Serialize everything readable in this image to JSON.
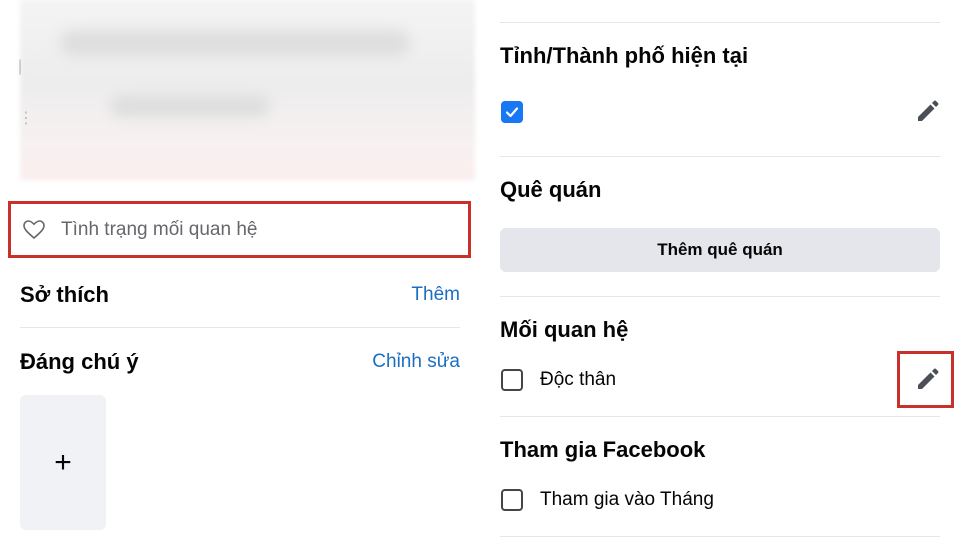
{
  "left": {
    "relationship_placeholder": "Tình trạng mối quan hệ",
    "interests": {
      "title": "Sở thích",
      "action": "Thêm"
    },
    "featured": {
      "title": "Đáng chú ý",
      "action": "Chỉnh sửa",
      "add_symbol": "+"
    }
  },
  "right": {
    "current_city": {
      "title": "Tỉnh/Thành phố hiện tại",
      "checked": true
    },
    "hometown": {
      "title": "Quê quán",
      "button": "Thêm quê quán"
    },
    "relationship": {
      "title": "Mối quan hệ",
      "option": "Độc thân",
      "checked": false
    },
    "joined": {
      "title": "Tham gia Facebook",
      "option": "Tham gia vào Tháng",
      "checked": false
    }
  },
  "colors": {
    "link": "#1b6ec2",
    "highlight": "#c9302c",
    "checkbox": "#1877f2"
  },
  "icons": [
    "heart-outline-icon",
    "pencil-icon",
    "check-icon",
    "plus-icon"
  ]
}
